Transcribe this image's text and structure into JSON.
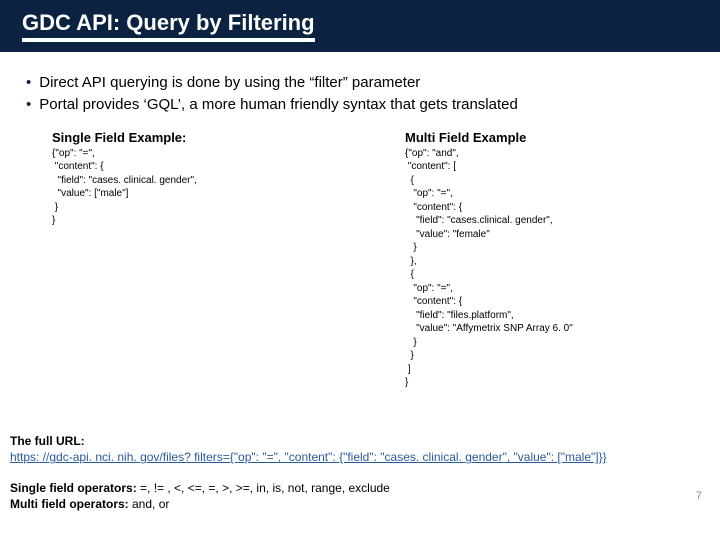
{
  "title": "GDC API: Query by Filtering",
  "bullets": [
    "Direct API querying is done by using the “filter” parameter",
    "Portal provides ‘GQL’, a more human friendly syntax that gets translated"
  ],
  "single": {
    "title": "Single Field Example:",
    "code": "{\"op\": \"=\",\n \"content\": {\n  \"field\": \"cases. clinical. gender\",\n  \"value\": [\"male\"]\n }\n}"
  },
  "multi": {
    "title": "Multi Field Example",
    "code": "{\"op\": \"and\",\n \"content\": [\n  {\n   \"op\": \"=\",\n   \"content\": {\n    \"field\": \"cases.clinical. gender\",\n    \"value\": \"female\"\n   }\n  },\n  {\n   \"op\": \"=\",\n   \"content\": {\n    \"field\": \"files.platform\",\n    \"value\": \"Affymetrix SNP Array 6. 0\"\n   }\n  }\n ]\n}"
  },
  "full_url_label": "The full URL:",
  "full_url": "https: //gdc-api. nci. nih. gov/files? filters={\"op\": \"=\", \"content\": {\"field\": \"cases. clinical. gender\", \"value\": [\"male\"]}}",
  "single_ops_label": "Single field operators:",
  "single_ops_list": " =, != , <, <=, =, >, >=, in, is, not, range, exclude",
  "multi_ops_label": "Multi field operators:",
  "multi_ops_list": " and, or",
  "page_number": "7"
}
